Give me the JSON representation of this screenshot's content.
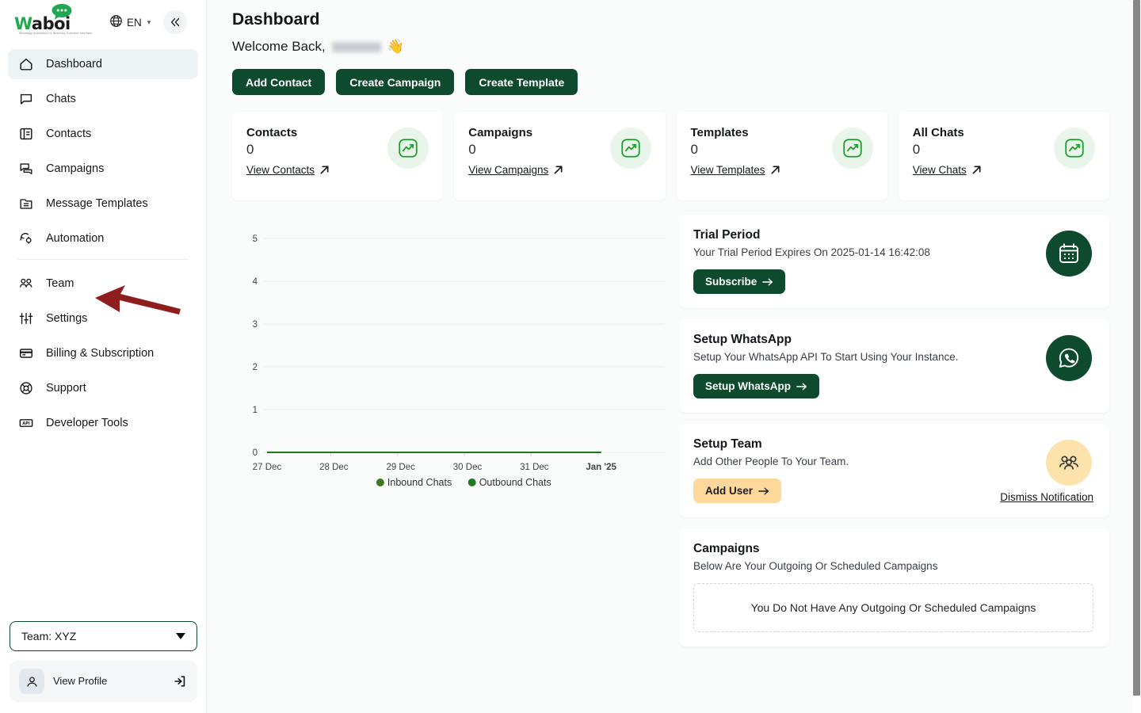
{
  "sidebar": {
    "logo": {
      "word_prefix": "W",
      "word_rest": "aboi",
      "tagline": "Whatsapp Automation & Business Outreach Interface"
    },
    "language": {
      "code": "EN",
      "icon": "globe-icon"
    },
    "collapse_icon": "chevron-double-left-icon",
    "items": [
      {
        "label": "Dashboard",
        "icon": "home-icon",
        "active": true
      },
      {
        "label": "Chats",
        "icon": "chat-bubble-icon",
        "active": false
      },
      {
        "label": "Contacts",
        "icon": "contacts-book-icon",
        "active": false
      },
      {
        "label": "Campaigns",
        "icon": "campaigns-icon",
        "active": false
      },
      {
        "label": "Message Templates",
        "icon": "template-folder-icon",
        "active": false
      },
      {
        "label": "Automation",
        "icon": "automation-gear-icon",
        "active": false
      }
    ],
    "items2": [
      {
        "label": "Team",
        "icon": "team-people-icon"
      },
      {
        "label": "Settings",
        "icon": "sliders-icon"
      },
      {
        "label": "Billing & Subscription",
        "icon": "credit-card-icon"
      },
      {
        "label": "Support",
        "icon": "lifebuoy-icon"
      },
      {
        "label": "Developer Tools",
        "icon": "api-icon"
      }
    ],
    "team_selector": {
      "label": "Team: XYZ",
      "icon": "caret-down-icon"
    },
    "profile": {
      "name_redacted": "",
      "sub_label": "View Profile",
      "avatar_icon": "user-avatar-icon",
      "logout_icon": "logout-icon"
    }
  },
  "header": {
    "title": "Dashboard",
    "welcome_prefix": "Welcome Back,",
    "welcome_name_redacted": "",
    "wave_emoji": "👋"
  },
  "actions": [
    {
      "label": "Add Contact"
    },
    {
      "label": "Create Campaign"
    },
    {
      "label": "Create Template"
    }
  ],
  "stats": [
    {
      "title": "Contacts",
      "value": "0",
      "link": "View Contacts",
      "link_icon": "arrow-up-right-icon",
      "icon": "trend-chart-icon"
    },
    {
      "title": "Campaigns",
      "value": "0",
      "link": "View Campaigns",
      "link_icon": "arrow-up-right-icon",
      "icon": "trend-chart-icon"
    },
    {
      "title": "Templates",
      "value": "0",
      "link": "View Templates",
      "link_icon": "arrow-up-right-icon",
      "icon": "trend-chart-icon"
    },
    {
      "title": "All Chats",
      "value": "0",
      "link": "View Chats",
      "link_icon": "arrow-up-right-icon",
      "icon": "trend-chart-icon"
    }
  ],
  "chart_data": {
    "type": "line",
    "title": "",
    "xlabel": "",
    "ylabel": "",
    "x": [
      "27 Dec",
      "28 Dec",
      "29 Dec",
      "30 Dec",
      "31 Dec",
      "Jan '25"
    ],
    "ytick_labels": [
      "0",
      "1",
      "2",
      "3",
      "4",
      "5"
    ],
    "ylim": [
      0,
      5
    ],
    "grid": true,
    "legend_position": "bottom",
    "series": [
      {
        "name": "Inbound Chats",
        "color": "#3d7a1f",
        "values": [
          0,
          0,
          0,
          0,
          0,
          0
        ]
      },
      {
        "name": "Outbound Chats",
        "color": "#1f7a1f",
        "values": [
          0,
          0,
          0,
          0,
          0,
          0
        ]
      }
    ]
  },
  "panels": {
    "trial": {
      "title": "Trial Period",
      "subtitle": "Your Trial Period Expires On 2025-01-14 16:42:08",
      "button": "Subscribe",
      "button_icon": "arrow-right-icon",
      "icon": "calendar-icon"
    },
    "whatsapp": {
      "title": "Setup WhatsApp",
      "subtitle": "Setup Your WhatsApp API To Start Using Your Instance.",
      "button": "Setup WhatsApp",
      "button_icon": "arrow-right-icon",
      "icon": "whatsapp-icon"
    },
    "team": {
      "title": "Setup Team",
      "subtitle": "Add Other People To Your Team.",
      "button": "Add User",
      "button_icon": "arrow-right-icon",
      "dismiss": "Dismiss Notification",
      "icon": "group-people-icon"
    },
    "campaigns": {
      "title": "Campaigns",
      "subtitle": "Below Are Your Outgoing Or Scheduled Campaigns",
      "empty_text": "You Do Not Have Any Outgoing Or Scheduled Campaigns"
    }
  },
  "colors": {
    "brand_dark_green": "#0d4a2e",
    "logo_green": "#1fa84f",
    "amber": "#ffd89b",
    "annotation_red": "#8f1d1d",
    "active_nav_bg": "#eef3f6"
  }
}
